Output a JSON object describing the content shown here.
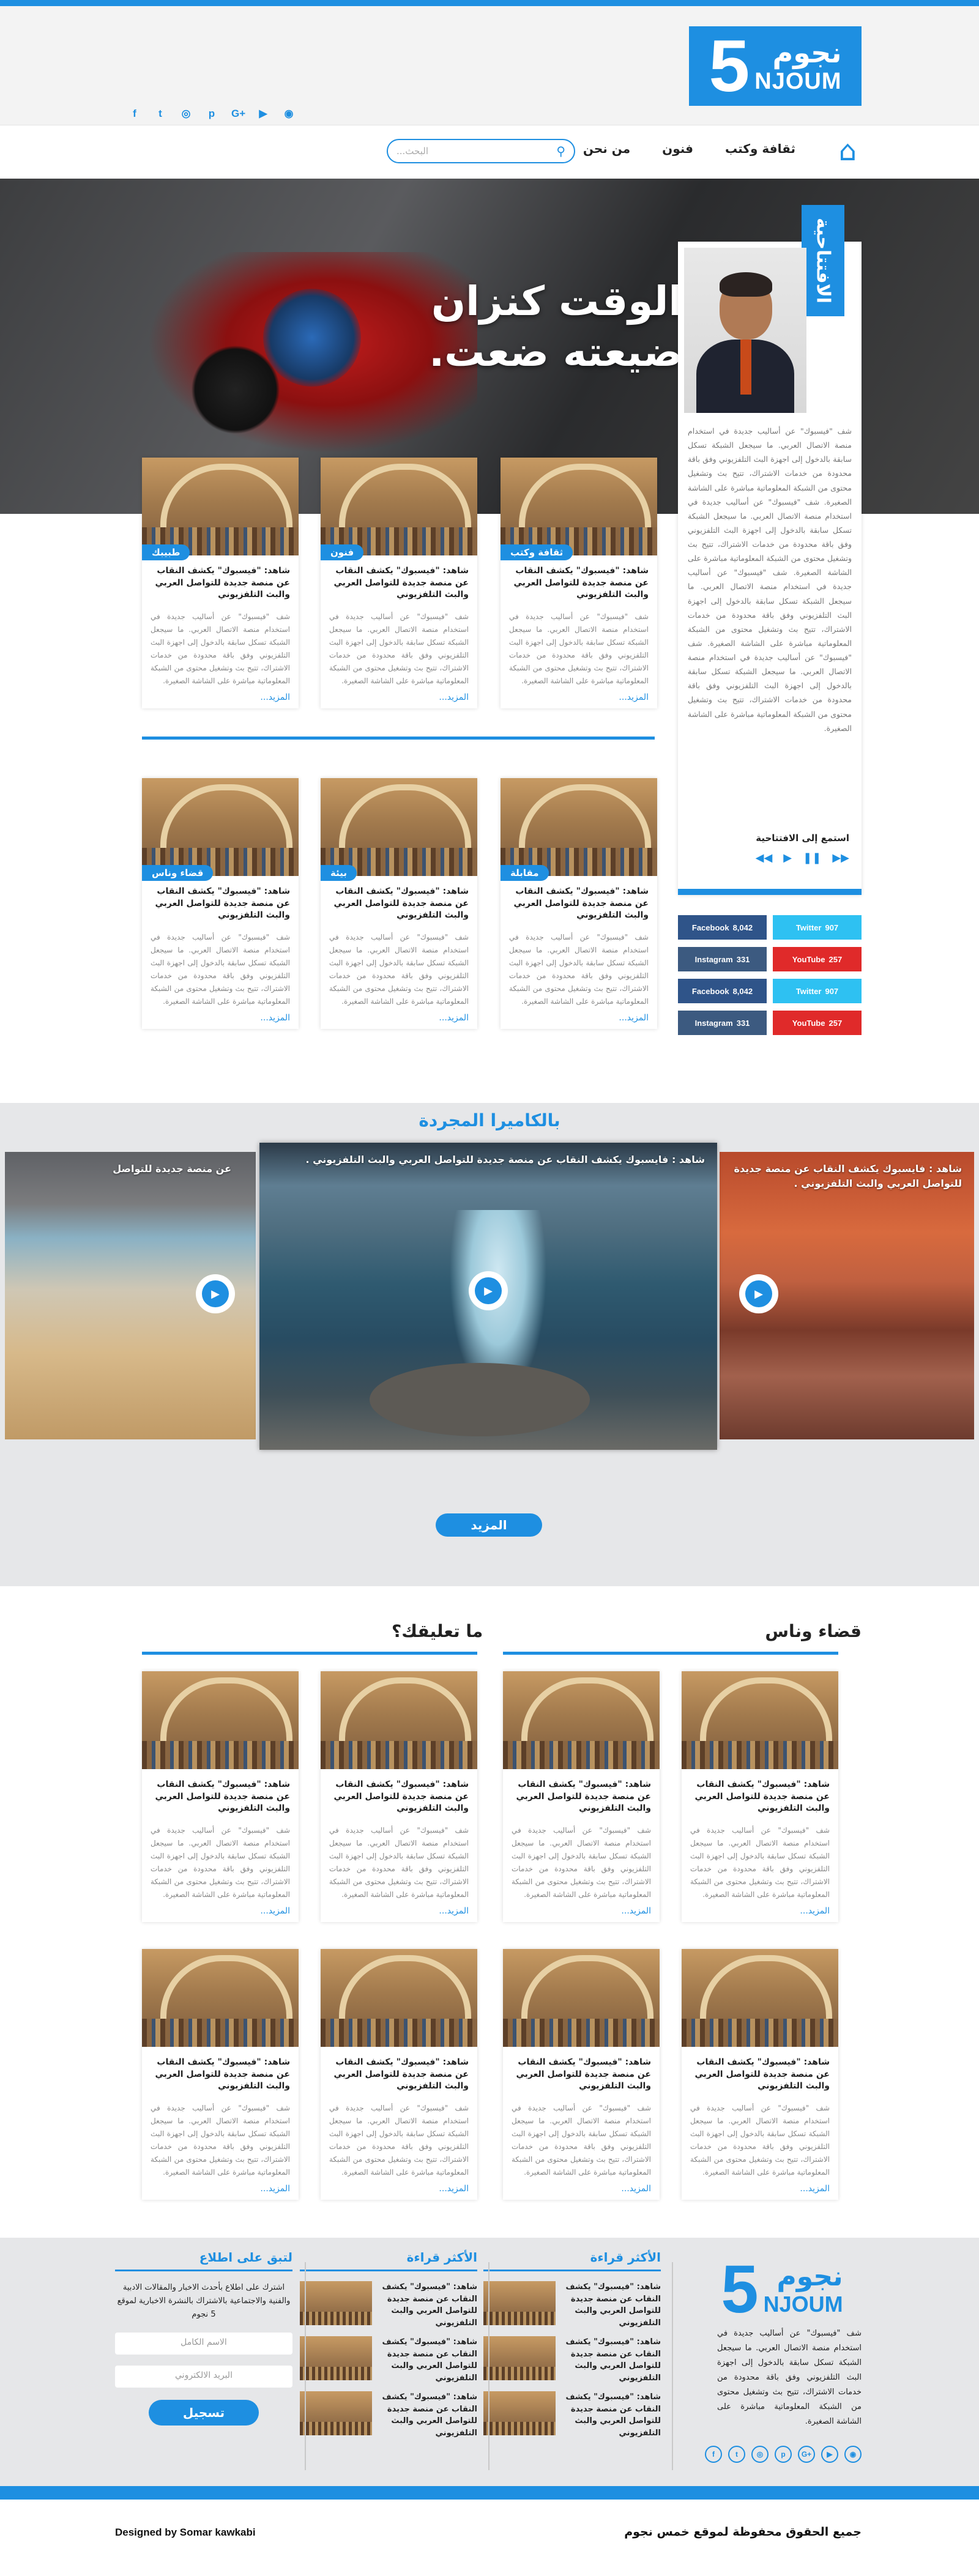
{
  "header": {
    "logo_ar": "نجوم",
    "logo_en": "NJOUM",
    "logo_num": "5",
    "socials": [
      "f",
      "t",
      "◎",
      "p",
      "G+",
      "▶",
      "◉"
    ]
  },
  "nav": {
    "items": [
      "ثقافة وكتب",
      "فنون",
      "من نحن"
    ],
    "search_placeholder": "البحث..."
  },
  "hero": {
    "headline_1": "الوقت كنزان",
    "headline_2": "ضيعته ضعت."
  },
  "editorial": {
    "tag": "الافتتاحية",
    "text": "شف \"فيسبوك\" عن أساليب جديدة في استخدام منصة الاتصال العربي. ما سيجعل الشبكة تسكل سابقة بالدخول إلى اجهزة البث التلفزيوني وفق باقة محدودة من خدمات الاشتراك، تتيح بث وتشغيل محتوى من الشبكة المعلوماتية مباشرة على الشاشة الصغيرة. شف \"فيسبوك\" عن أساليب جديدة في استخدام منصة الاتصال العربي. ما سيجعل الشبكة تسكل سابقة بالدخول إلى اجهزة البث التلفزيوني وفق باقة محدودة من خدمات الاشتراك، تتيح بث وتشغيل محتوى من الشبكة المعلوماتية مباشرة على الشاشة الصغيرة. شف \"فيسبوك\" عن أساليب جديدة في استخدام منصة الاتصال العربي. ما سيجعل الشبكة تسكل سابقة بالدخول إلى اجهزة البث التلفزيوني وفق باقة محدودة من خدمات الاشتراك، تتيح بث وتشغيل محتوى من الشبكة المعلوماتية مباشرة على الشاشة الصغيرة. شف \"فيسبوك\" عن أساليب جديدة في استخدام منصة الاتصال العربي. ما سيجعل الشبكة تسكل سابقة بالدخول إلى اجهزة البث التلفزيوني وفق باقة محدودة من خدمات الاشتراك، تتيح بث وتشغيل محتوى من الشبكة المعلوماتية مباشرة على الشاشة الصغيرة.",
    "listen_label": "استمع إلى الافتتاحية",
    "player": [
      "◀◀",
      "▶",
      "❚❚",
      "▶▶"
    ]
  },
  "social_counts": [
    {
      "name": "Twitter",
      "count": "907",
      "cls": "tw"
    },
    {
      "name": "Facebook",
      "count": "8,042",
      "cls": "fb"
    },
    {
      "name": "YouTube",
      "count": "257",
      "cls": "yt"
    },
    {
      "name": "Instagram",
      "count": "331",
      "cls": "ig"
    },
    {
      "name": "Twitter",
      "count": "907",
      "cls": "tw"
    },
    {
      "name": "Facebook",
      "count": "8,042",
      "cls": "fb"
    },
    {
      "name": "YouTube",
      "count": "257",
      "cls": "yt"
    },
    {
      "name": "Instagram",
      "count": "331",
      "cls": "ig"
    }
  ],
  "article": {
    "title": "شاهد: \"فيسبوك\" يكشف النقاب عن منصة جديدة للتواصل العربي والبث التلفزيوني",
    "body": "شف \"فيسبوك\" عن أساليب جديدة في استخدام منصة الاتصال العربي. ما سيجعل الشبكة تسكل سابقة بالدخول إلى اجهزة البث التلفزيوني وفق باقة محدودة من خدمات الاشتراك، تتيح بث وتشغيل محتوى من الشبكة المعلوماتية مباشرة على الشاشة الصغيرة.",
    "more": "المزيد..."
  },
  "row1_badges": [
    "ثقافة وكتب",
    "فنون",
    "طبيبك"
  ],
  "row2_badges": [
    "مقابلة",
    "بيئة",
    "قضاء وناس"
  ],
  "camera": {
    "title": "بالكاميرا المجردة",
    "caption": "شاهد : فايسبوك يكشف النقاب عن منصة جديدة للتواصل العربي والبث التلفزيوني .",
    "caption_short": "عن منصة جديدة للتواصل",
    "more_button": "المزيد"
  },
  "sections": {
    "right": "قضاء وناس",
    "left": "ما تعليقك؟"
  },
  "footer": {
    "about": "شف \"فيسبوك\" عن أساليب جديدة في استخدام منصة الاتصال العربي. ما سيجعل الشبكة تسكل سابقة بالدخول إلى اجهزة البث التلفزيوني وفق باقة محدودة من خدمات الاشتراك، تتيح بث وتشغيل محتوى من الشبكة المعلوماتية مباشرة على الشاشة الصغيرة.",
    "most_read": "الأكثر قراءة",
    "most_read_item": "شاهد: \"فيسبوك\" يكشف النقاب عن منصة جديدة للتواصل العربي والبث التلفزيوني",
    "newsletter_title": "لتبق على اطلاع",
    "newsletter_text": "اشترك على اطلاع بأحدث الاخبار والمقالات الادبية والفنية والاجتماعية بالاشتراك بالنشرة الاخبارية لموقع 5 نجوم",
    "name_placeholder": "الاسم الكامل",
    "email_placeholder": "البريد الالكتروني",
    "register": "تسجيل",
    "socials": [
      "f",
      "t",
      "◎",
      "p",
      "G+",
      "▶",
      "◉"
    ]
  },
  "copyright": "جميع الحقوق محفوظة لموقع خمس نجوم",
  "credits": "Designed by Somar kawkabi",
  "colors": {
    "accent": "#1e8fe1"
  }
}
